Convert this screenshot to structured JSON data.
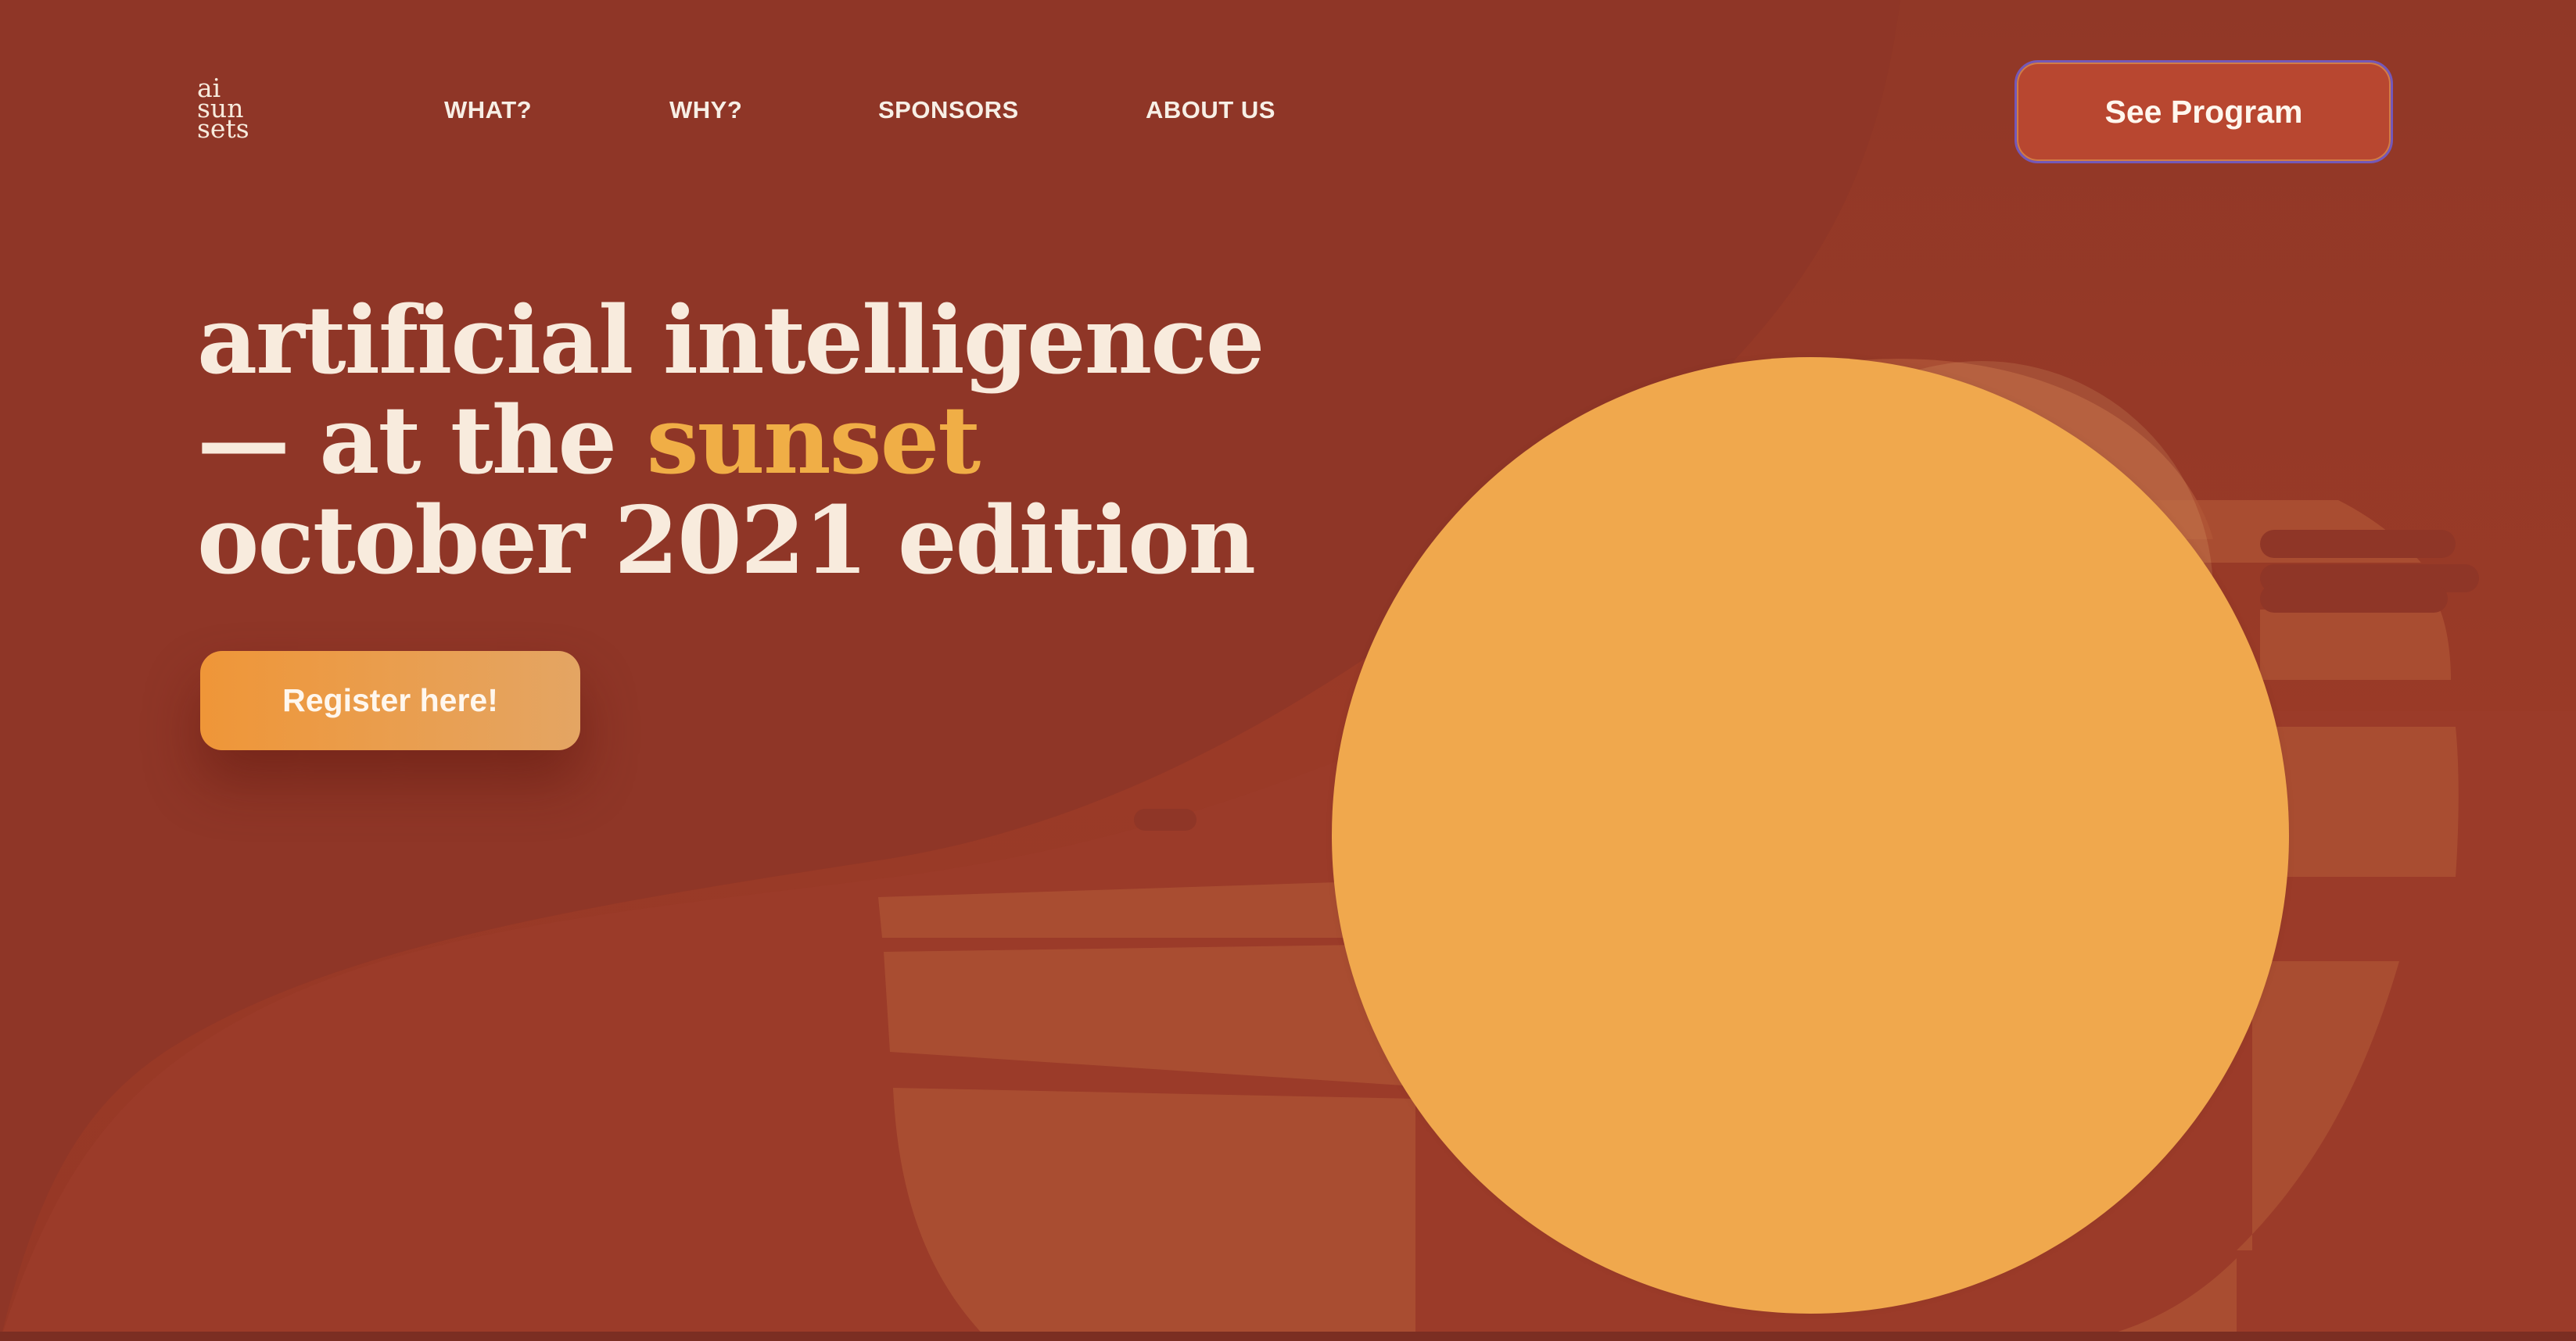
{
  "header": {
    "logo_lines": [
      "ai",
      "sun",
      "sets"
    ],
    "nav": [
      "WHAT?",
      "WHY?",
      "SPONSORS",
      "ABOUT US"
    ],
    "cta": "See Program"
  },
  "hero": {
    "line1": "artificial intelligence",
    "line2_prefix": "— at the ",
    "line2_accent": "sunset",
    "line3": "october 2021 edition",
    "register": "Register here!"
  },
  "colors": {
    "background": "#963826",
    "accent": "#f0ae46",
    "sun": "#f0a84d",
    "button": "#b84730",
    "text": "#f8ebdd"
  }
}
